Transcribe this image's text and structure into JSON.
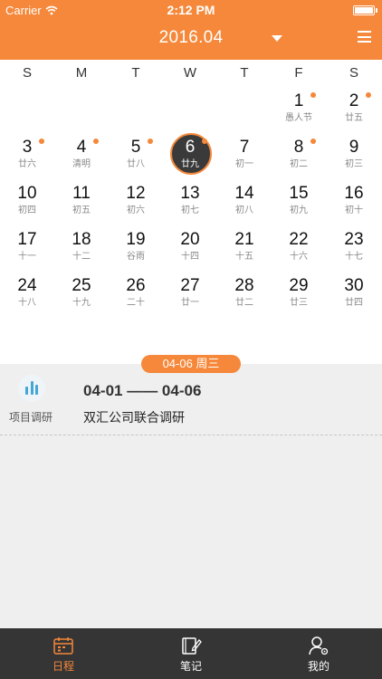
{
  "status": {
    "carrier": "Carrier",
    "time": "2:12 PM"
  },
  "header": {
    "month": "2016.04"
  },
  "weekdays": [
    "S",
    "M",
    "T",
    "W",
    "T",
    "F",
    "S"
  ],
  "days": [
    {
      "num": "1",
      "lunar": "愚人节",
      "dot": true,
      "col": 5,
      "row": 0
    },
    {
      "num": "2",
      "lunar": "廿五",
      "dot": true,
      "col": 6,
      "row": 0
    },
    {
      "num": "3",
      "lunar": "廿六",
      "dot": true,
      "col": 0,
      "row": 1
    },
    {
      "num": "4",
      "lunar": "清明",
      "dot": true,
      "col": 1,
      "row": 1
    },
    {
      "num": "5",
      "lunar": "廿八",
      "dot": true,
      "col": 2,
      "row": 1
    },
    {
      "num": "6",
      "lunar": "廿九",
      "dot": true,
      "selected": true,
      "col": 3,
      "row": 1
    },
    {
      "num": "7",
      "lunar": "初一",
      "col": 4,
      "row": 1
    },
    {
      "num": "8",
      "lunar": "初二",
      "dot": true,
      "col": 5,
      "row": 1
    },
    {
      "num": "9",
      "lunar": "初三",
      "col": 6,
      "row": 1
    },
    {
      "num": "10",
      "lunar": "初四",
      "col": 0,
      "row": 2
    },
    {
      "num": "11",
      "lunar": "初五",
      "col": 1,
      "row": 2
    },
    {
      "num": "12",
      "lunar": "初六",
      "col": 2,
      "row": 2
    },
    {
      "num": "13",
      "lunar": "初七",
      "col": 3,
      "row": 2
    },
    {
      "num": "14",
      "lunar": "初八",
      "col": 4,
      "row": 2
    },
    {
      "num": "15",
      "lunar": "初九",
      "col": 5,
      "row": 2
    },
    {
      "num": "16",
      "lunar": "初十",
      "col": 6,
      "row": 2
    },
    {
      "num": "17",
      "lunar": "十一",
      "col": 0,
      "row": 3
    },
    {
      "num": "18",
      "lunar": "十二",
      "col": 1,
      "row": 3
    },
    {
      "num": "19",
      "lunar": "谷雨",
      "col": 2,
      "row": 3
    },
    {
      "num": "20",
      "lunar": "十四",
      "col": 3,
      "row": 3
    },
    {
      "num": "21",
      "lunar": "十五",
      "col": 4,
      "row": 3
    },
    {
      "num": "22",
      "lunar": "十六",
      "col": 5,
      "row": 3
    },
    {
      "num": "23",
      "lunar": "十七",
      "col": 6,
      "row": 3
    },
    {
      "num": "24",
      "lunar": "十八",
      "col": 0,
      "row": 4
    },
    {
      "num": "25",
      "lunar": "十九",
      "col": 1,
      "row": 4
    },
    {
      "num": "26",
      "lunar": "二十",
      "col": 2,
      "row": 4
    },
    {
      "num": "27",
      "lunar": "廿一",
      "col": 3,
      "row": 4
    },
    {
      "num": "28",
      "lunar": "廿二",
      "col": 4,
      "row": 4
    },
    {
      "num": "29",
      "lunar": "廿三",
      "col": 5,
      "row": 4
    },
    {
      "num": "30",
      "lunar": "廿四",
      "col": 6,
      "row": 4
    }
  ],
  "selected_date": "04-06 周三",
  "event": {
    "category": "项目调研",
    "category_icon": "bar-chart-icon",
    "range": "04-01 —— 04-06",
    "title": "双汇公司联合调研"
  },
  "tabs": [
    {
      "label": "日程",
      "icon": "calendar-icon",
      "active": true
    },
    {
      "label": "笔记",
      "icon": "notebook-icon",
      "active": false
    },
    {
      "label": "我的",
      "icon": "user-settings-icon",
      "active": false
    }
  ],
  "colors": {
    "accent": "#f5883a",
    "tabbar": "#353535",
    "selected_day": "#3a3a3a",
    "event_icon": "#45a6d6"
  }
}
